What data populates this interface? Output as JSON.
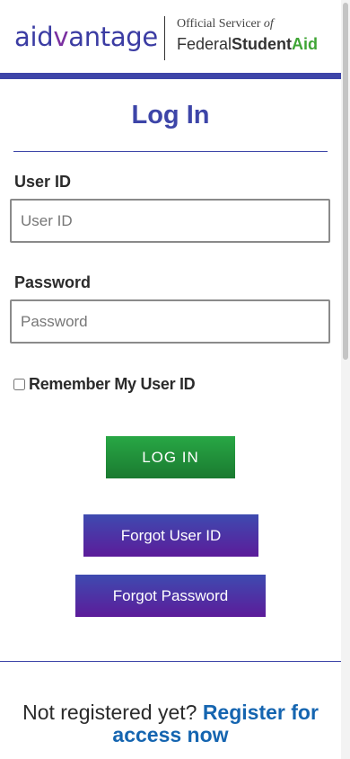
{
  "header": {
    "logo": {
      "part1": "aid",
      "part2": "v",
      "part3": "antage"
    },
    "servicer_line1": "Official Servicer",
    "servicer_of": "of",
    "servicer_federal": "Federal",
    "servicer_student": "Student",
    "servicer_aid": "Aid"
  },
  "login": {
    "title": "Log In",
    "user_id_label": "User ID",
    "user_id_placeholder": "User ID",
    "user_id_value": "",
    "password_label": "Password",
    "password_placeholder": "Password",
    "password_value": "",
    "remember_label": "Remember My User ID",
    "remember_checked": false,
    "login_button": "LOG IN",
    "forgot_user_id_button": "Forgot User ID",
    "forgot_password_button": "Forgot Password"
  },
  "register": {
    "prompt": "Not registered yet?",
    "link": "Register for access now"
  },
  "colors": {
    "brand_blue": "#3d45a8",
    "brand_purple": "#7a2fa0",
    "login_green": "#28a745",
    "aid_green": "#3fa535",
    "link_blue": "#1565b0"
  }
}
